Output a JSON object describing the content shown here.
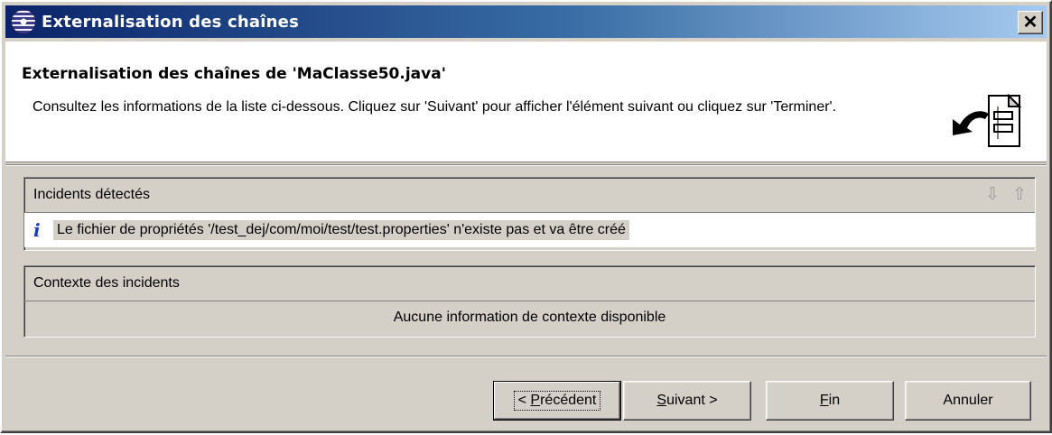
{
  "window": {
    "title": "Externalisation des chaînes",
    "close_label": "✕"
  },
  "banner": {
    "title": "Externalisation des chaînes de 'MaClasse50.java'",
    "description": "Consultez les informations de la liste ci-dessous. Cliquez sur 'Suivant' pour afficher l'élément suivant ou cliquez sur 'Terminer'."
  },
  "issues": {
    "header": "Incidents détectés",
    "down_arrow": "⇩",
    "up_arrow": "⇧",
    "items": [
      {
        "icon": "i",
        "text": "Le fichier de propriétés '/test_dej/com/moi/test/test.properties' n'existe pas et va être créé"
      }
    ]
  },
  "context": {
    "header": "Contexte des incidents",
    "message": "Aucune information de contexte disponible"
  },
  "buttons": {
    "previous": {
      "prefix": "< ",
      "mnemonic": "P",
      "rest": "récédent"
    },
    "next": {
      "mnemonic": "S",
      "rest": "uivant >"
    },
    "finish": {
      "mnemonic": "F",
      "rest": "in"
    },
    "cancel": {
      "label": "Annuler"
    }
  }
}
